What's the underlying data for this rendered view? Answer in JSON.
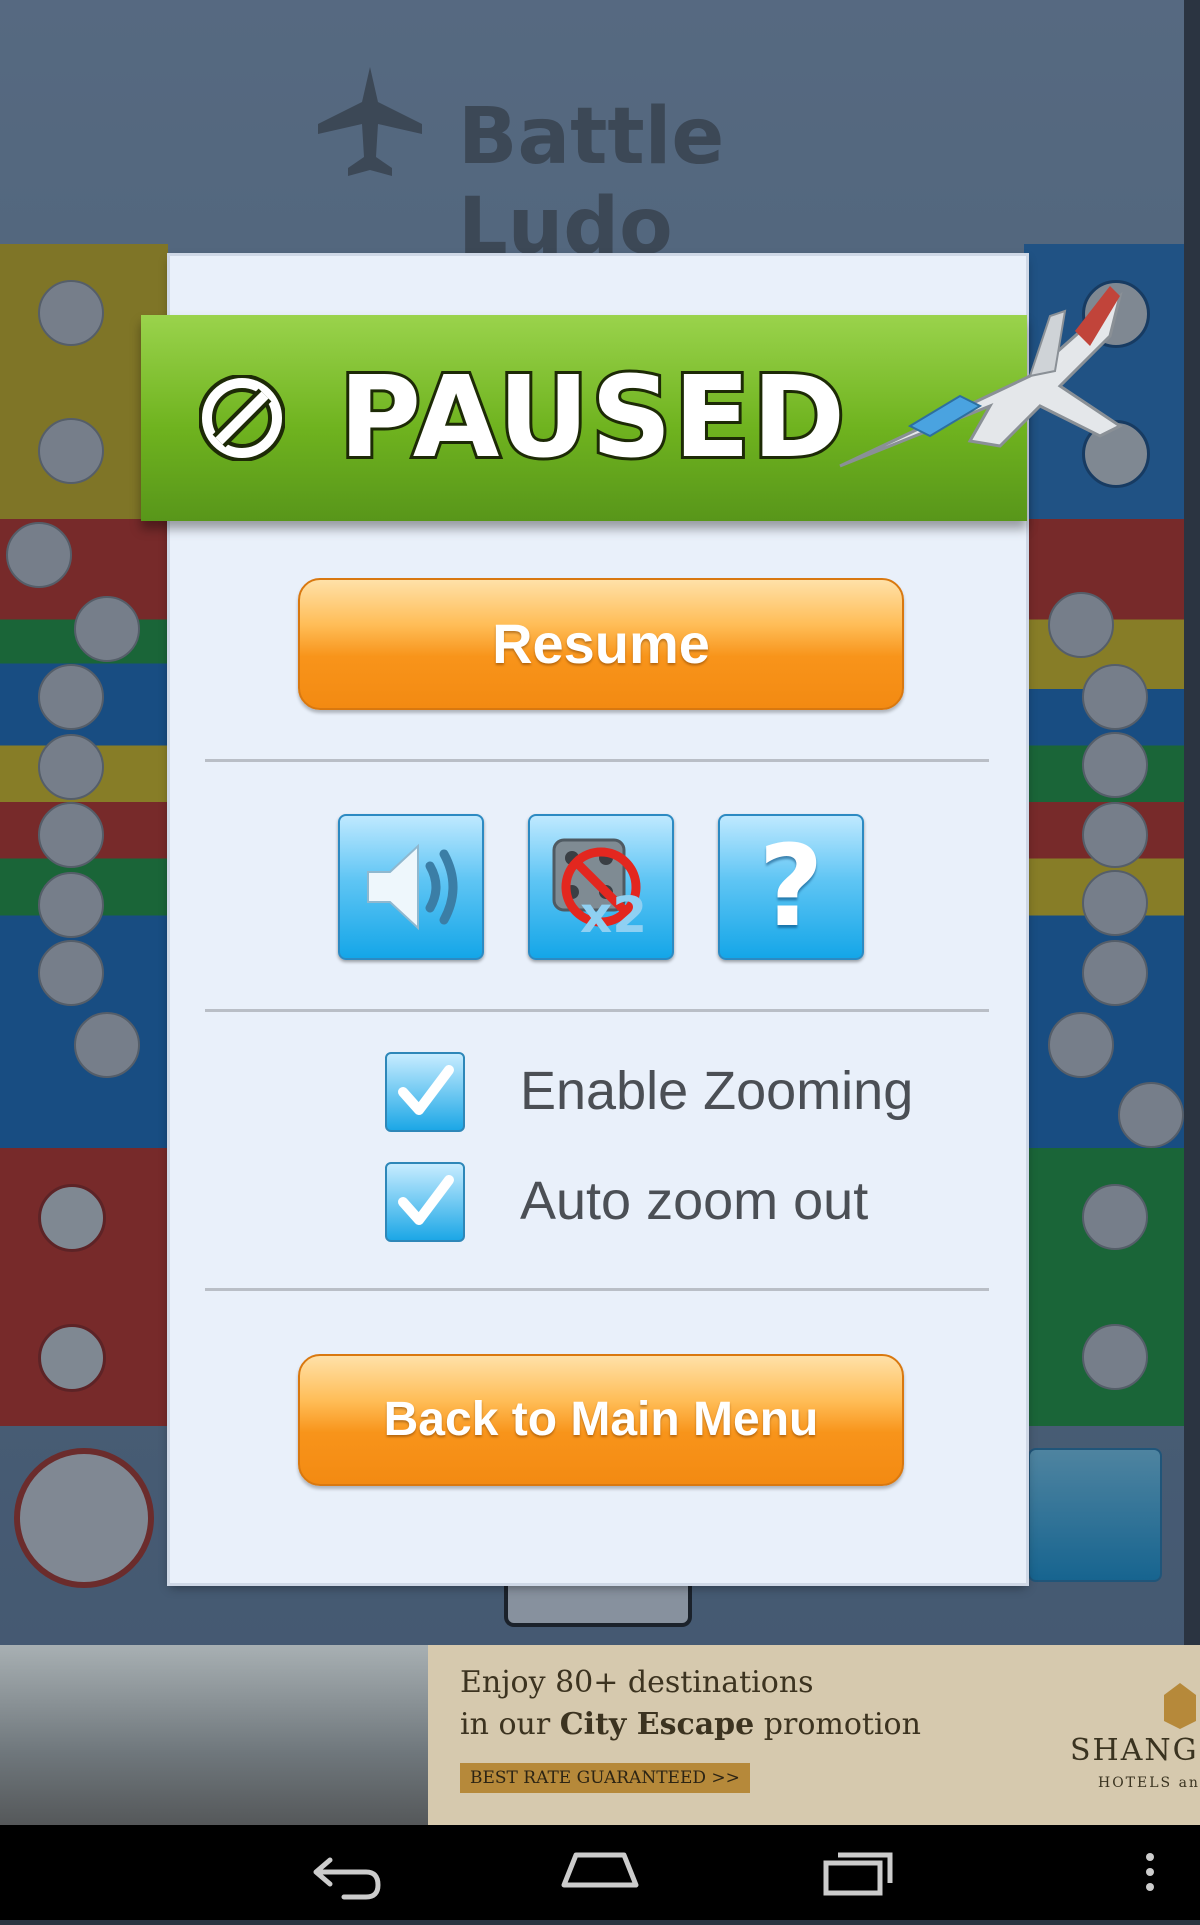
{
  "game": {
    "title": "Battle Ludo"
  },
  "dialog": {
    "title": "PAUSED",
    "resume_label": "Resume",
    "icon_buttons": [
      "sound-icon",
      "double-dice-disabled-icon",
      "help-icon"
    ],
    "dice_badge": "x2",
    "help_glyph": "?",
    "options": [
      {
        "label": "Enable Zooming",
        "checked": true
      },
      {
        "label": "Auto zoom out",
        "checked": true
      }
    ],
    "back_label": "Back to Main Menu"
  },
  "ad": {
    "line1": "Enjoy 80+ destinations",
    "line2_pre": "in our ",
    "line2_bold": "City Escape",
    "line2_post": " promotion",
    "badge": "BEST RATE GUARANTEED >>",
    "brand": "SHANGR",
    "brand_sub": "HOTELS and R"
  },
  "navbar": {
    "buttons": [
      "back-icon",
      "home-icon",
      "recents-icon",
      "overflow-menu-icon"
    ]
  },
  "colors": {
    "accent_orange": "#f38a12",
    "banner_green": "#6fb31f",
    "button_blue": "#14a6e8",
    "board_red": "#c9301f",
    "board_yellow": "#e6c61b",
    "board_blue": "#1d6fc0",
    "board_green": "#1f9b3a"
  }
}
